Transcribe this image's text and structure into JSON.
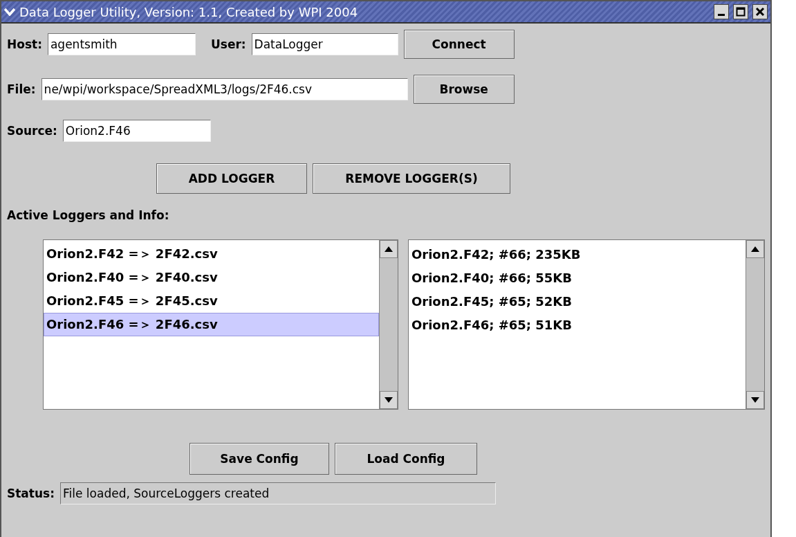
{
  "window": {
    "title": "Data Logger Utility, Version: 1.1, Created by WPI 2004"
  },
  "connection": {
    "host_label": "Host:",
    "host_value": "agentsmith",
    "user_label": "User:",
    "user_value": "DataLogger",
    "connect_button": "Connect"
  },
  "file": {
    "label": "File:",
    "value": "ne/wpi/workspace/SpreadXML3/logs/2F46.csv",
    "browse_button": "Browse"
  },
  "source": {
    "label": "Source:",
    "value": "Orion2.F46"
  },
  "logger_buttons": [
    "ADD LOGGER",
    "REMOVE LOGGER(S)"
  ],
  "active_label": "Active Loggers and Info:",
  "loggers": [
    {
      "text": "Orion2.F42 =＞ 2F42.csv",
      "selected": false
    },
    {
      "text": "Orion2.F40 =＞ 2F40.csv",
      "selected": false
    },
    {
      "text": "Orion2.F45 =＞ 2F45.csv",
      "selected": false
    },
    {
      "text": "Orion2.F46 =＞ 2F46.csv",
      "selected": true
    }
  ],
  "info": [
    "Orion2.F42; #66; 235KB",
    "Orion2.F40; #66; 55KB",
    "Orion2.F45; #65; 52KB",
    "Orion2.F46; #65; 51KB"
  ],
  "config_buttons": [
    "Save Config",
    "Load Config"
  ],
  "status": {
    "label": "Status:",
    "value": "File loaded, SourceLoggers created"
  }
}
